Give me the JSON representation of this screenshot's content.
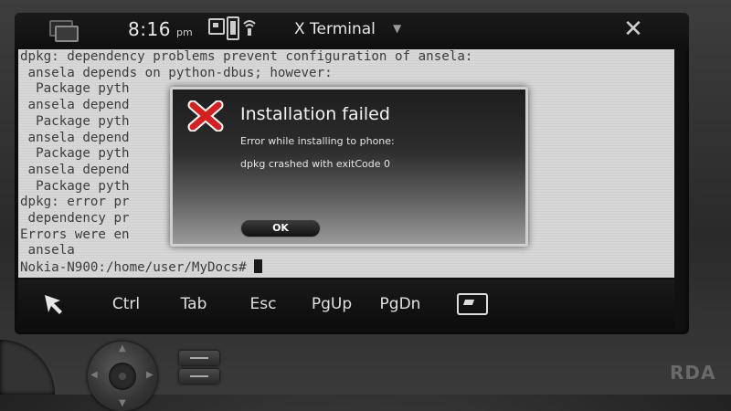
{
  "status_bar": {
    "time": "8:16",
    "ampm": "pm",
    "app_title": "X Terminal",
    "title_menu_arrow": "▼",
    "close_glyph": "✕"
  },
  "terminal": {
    "lines": [
      "dpkg: dependency problems prevent configuration of ansela:",
      " ansela depends on python-dbus; however:",
      "  Package pyth",
      " ansela depend",
      "  Package pyth",
      " ansela depend",
      "  Package pyth",
      " ansela depend",
      "  Package pyth",
      "dpkg: error pr",
      " dependency pr",
      "Errors were en",
      " ansela",
      "Nokia-N900:/home/user/MyDocs# "
    ]
  },
  "toolbar": {
    "ctrl": "Ctrl",
    "tab": "Tab",
    "esc": "Esc",
    "pgup": "PgUp",
    "pgdn": "PgDn"
  },
  "dialog": {
    "title": "Installation failed",
    "message_line1": "Error while installing to phone:",
    "message_line2": "dpkg crashed with exitCode 0",
    "ok_label": "OK",
    "icon": "error-x-icon"
  },
  "watermark": "RDA",
  "colors": {
    "terminal_bg": "#d7d7d7",
    "terminal_text": "#3c3c3c",
    "error_icon_red": "#d42020"
  }
}
